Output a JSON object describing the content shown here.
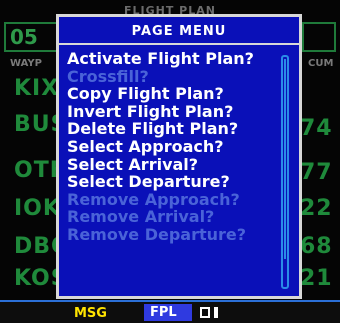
{
  "background": {
    "title": "FLIGHT PLAN",
    "header_left": "05",
    "col_left_label": "WAYP",
    "col_right_label": "CUM",
    "rows_left": [
      "KIX",
      "BUS",
      "OTH",
      "IOK",
      "DBO",
      "KOS"
    ],
    "rows_right": [
      "",
      "74",
      "77",
      "22",
      "68",
      "21"
    ]
  },
  "menu": {
    "title": "PAGE MENU",
    "items": [
      {
        "label": "Activate Flight Plan?",
        "state": "selected"
      },
      {
        "label": "Crossfill?",
        "state": "disabled"
      },
      {
        "label": "Copy Flight Plan?",
        "state": "enabled"
      },
      {
        "label": "Invert Flight Plan?",
        "state": "enabled"
      },
      {
        "label": "Delete Flight Plan?",
        "state": "enabled"
      },
      {
        "label": "Select Approach?",
        "state": "enabled"
      },
      {
        "label": "Select Arrival?",
        "state": "enabled"
      },
      {
        "label": "Select Departure?",
        "state": "enabled"
      },
      {
        "label": "Remove Approach?",
        "state": "disabled"
      },
      {
        "label": "Remove Arrival?",
        "state": "disabled"
      },
      {
        "label": "Remove Departure?",
        "state": "disabled"
      }
    ]
  },
  "bottom_bar": {
    "msg": "MSG",
    "page": "FPL"
  },
  "colors": {
    "menu_bg": "#0a10b8",
    "menu_enabled": "#ffffff",
    "menu_disabled": "#4a63d8",
    "msg": "#ffe400",
    "page_bg": "#2f3ae0",
    "background_text": "#1f8a3b"
  }
}
